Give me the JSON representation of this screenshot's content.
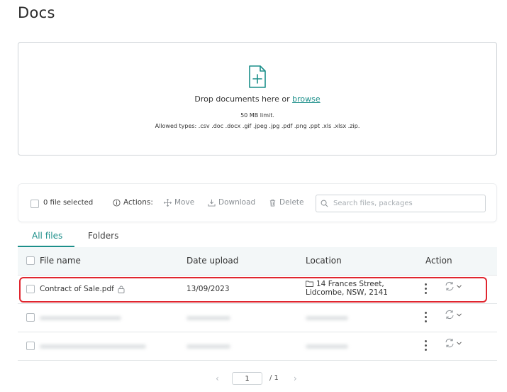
{
  "page": {
    "title": "Docs"
  },
  "upload": {
    "prompt": "Drop documents here or ",
    "browse_label": "browse",
    "limit": "50 MB limit.",
    "allowed_types": "Allowed types: .csv .doc .docx .gif .jpeg .jpg .pdf .png .ppt .xls .xlsx .zip."
  },
  "toolbar": {
    "selected_label": "0 file selected",
    "actions_label": "Actions:",
    "move_label": "Move",
    "download_label": "Download",
    "delete_label": "Delete",
    "search_placeholder": "Search files, packages"
  },
  "tabs": [
    {
      "label": "All files",
      "active": true
    },
    {
      "label": "Folders",
      "active": false
    }
  ],
  "table": {
    "columns": [
      "File name",
      "Date upload",
      "Location",
      "Action"
    ],
    "rows": [
      {
        "file_name": "Contract of Sale.pdf",
        "date": "13/09/2023",
        "location_line1": "14 Frances Street,",
        "location_line2": "Lidcombe, NSW, 2141",
        "locked": true
      }
    ]
  },
  "pagination": {
    "current": "1",
    "total": "/ 1"
  },
  "colors": {
    "accent": "#1c8f8a",
    "highlight": "#e0262f"
  }
}
